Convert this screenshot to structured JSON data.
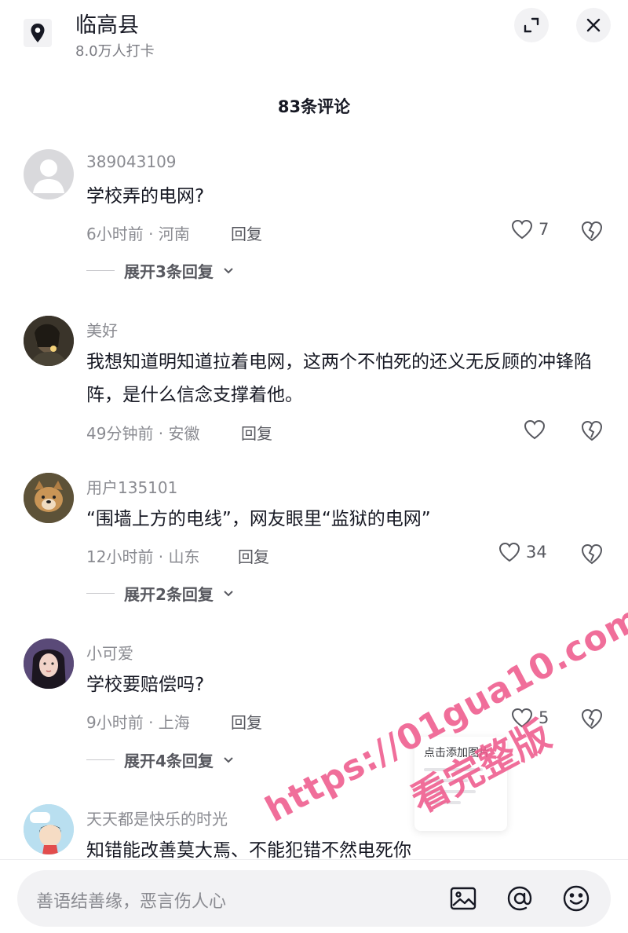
{
  "header": {
    "location_name": "临高县",
    "checkins": "8.0万人打卡",
    "icons": {
      "pin": "location-pin-icon",
      "expand": "expand-icon",
      "close": "close-icon"
    }
  },
  "comments_title": "83条评论",
  "comments": [
    {
      "user": "389043109",
      "text": "学校弄的电网?",
      "time_loc": "6小时前 · 河南",
      "reply": "回复",
      "likes": "7",
      "expand": "展开3条回复"
    },
    {
      "user": "美好",
      "text": "我想知道明知道拉着电网，这两个不怕死的还义无反顾的冲锋陷阵，是什么信念支撑着他。",
      "time_loc": "49分钟前 · 安徽",
      "reply": "回复",
      "likes": ""
    },
    {
      "user": "用户135101",
      "text": "“围墙上方的电线”，网友眼里“监狱的电网”",
      "time_loc": "12小时前 · 山东",
      "reply": "回复",
      "likes": "34",
      "expand": "展开2条回复"
    },
    {
      "user": "小可爱",
      "text": "学校要赔偿吗?",
      "time_loc": "9小时前 · 上海",
      "reply": "回复",
      "likes": "5",
      "expand": "展开4条回复"
    },
    {
      "user": "天天都是快乐的时光",
      "text": "知错能改善莫大焉、不能犯错不然电死你"
    }
  ],
  "add_image_card": {
    "title": "点击添加图片"
  },
  "watermark": {
    "url": "https://01gua10.com",
    "slogan": "看完整版"
  },
  "input": {
    "placeholder": "善语结善缘，恶言伤人心"
  },
  "colors": {
    "text": "#161823",
    "secondary": "#8a8b91",
    "watermark": "#ee5a8c",
    "input_bg": "#f2f2f4"
  }
}
